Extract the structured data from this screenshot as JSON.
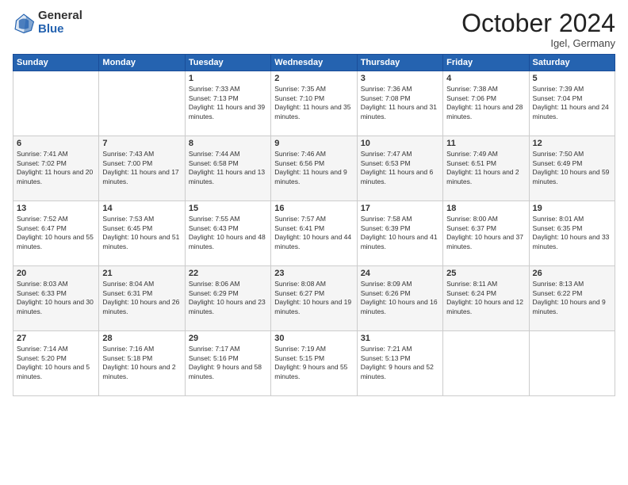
{
  "logo": {
    "general": "General",
    "blue": "Blue"
  },
  "header": {
    "month": "October 2024",
    "location": "Igel, Germany"
  },
  "weekdays": [
    "Sunday",
    "Monday",
    "Tuesday",
    "Wednesday",
    "Thursday",
    "Friday",
    "Saturday"
  ],
  "weeks": [
    [
      {
        "day": "",
        "sunrise": "",
        "sunset": "",
        "daylight": ""
      },
      {
        "day": "",
        "sunrise": "",
        "sunset": "",
        "daylight": ""
      },
      {
        "day": "1",
        "sunrise": "Sunrise: 7:33 AM",
        "sunset": "Sunset: 7:13 PM",
        "daylight": "Daylight: 11 hours and 39 minutes."
      },
      {
        "day": "2",
        "sunrise": "Sunrise: 7:35 AM",
        "sunset": "Sunset: 7:10 PM",
        "daylight": "Daylight: 11 hours and 35 minutes."
      },
      {
        "day": "3",
        "sunrise": "Sunrise: 7:36 AM",
        "sunset": "Sunset: 7:08 PM",
        "daylight": "Daylight: 11 hours and 31 minutes."
      },
      {
        "day": "4",
        "sunrise": "Sunrise: 7:38 AM",
        "sunset": "Sunset: 7:06 PM",
        "daylight": "Daylight: 11 hours and 28 minutes."
      },
      {
        "day": "5",
        "sunrise": "Sunrise: 7:39 AM",
        "sunset": "Sunset: 7:04 PM",
        "daylight": "Daylight: 11 hours and 24 minutes."
      }
    ],
    [
      {
        "day": "6",
        "sunrise": "Sunrise: 7:41 AM",
        "sunset": "Sunset: 7:02 PM",
        "daylight": "Daylight: 11 hours and 20 minutes."
      },
      {
        "day": "7",
        "sunrise": "Sunrise: 7:43 AM",
        "sunset": "Sunset: 7:00 PM",
        "daylight": "Daylight: 11 hours and 17 minutes."
      },
      {
        "day": "8",
        "sunrise": "Sunrise: 7:44 AM",
        "sunset": "Sunset: 6:58 PM",
        "daylight": "Daylight: 11 hours and 13 minutes."
      },
      {
        "day": "9",
        "sunrise": "Sunrise: 7:46 AM",
        "sunset": "Sunset: 6:56 PM",
        "daylight": "Daylight: 11 hours and 9 minutes."
      },
      {
        "day": "10",
        "sunrise": "Sunrise: 7:47 AM",
        "sunset": "Sunset: 6:53 PM",
        "daylight": "Daylight: 11 hours and 6 minutes."
      },
      {
        "day": "11",
        "sunrise": "Sunrise: 7:49 AM",
        "sunset": "Sunset: 6:51 PM",
        "daylight": "Daylight: 11 hours and 2 minutes."
      },
      {
        "day": "12",
        "sunrise": "Sunrise: 7:50 AM",
        "sunset": "Sunset: 6:49 PM",
        "daylight": "Daylight: 10 hours and 59 minutes."
      }
    ],
    [
      {
        "day": "13",
        "sunrise": "Sunrise: 7:52 AM",
        "sunset": "Sunset: 6:47 PM",
        "daylight": "Daylight: 10 hours and 55 minutes."
      },
      {
        "day": "14",
        "sunrise": "Sunrise: 7:53 AM",
        "sunset": "Sunset: 6:45 PM",
        "daylight": "Daylight: 10 hours and 51 minutes."
      },
      {
        "day": "15",
        "sunrise": "Sunrise: 7:55 AM",
        "sunset": "Sunset: 6:43 PM",
        "daylight": "Daylight: 10 hours and 48 minutes."
      },
      {
        "day": "16",
        "sunrise": "Sunrise: 7:57 AM",
        "sunset": "Sunset: 6:41 PM",
        "daylight": "Daylight: 10 hours and 44 minutes."
      },
      {
        "day": "17",
        "sunrise": "Sunrise: 7:58 AM",
        "sunset": "Sunset: 6:39 PM",
        "daylight": "Daylight: 10 hours and 41 minutes."
      },
      {
        "day": "18",
        "sunrise": "Sunrise: 8:00 AM",
        "sunset": "Sunset: 6:37 PM",
        "daylight": "Daylight: 10 hours and 37 minutes."
      },
      {
        "day": "19",
        "sunrise": "Sunrise: 8:01 AM",
        "sunset": "Sunset: 6:35 PM",
        "daylight": "Daylight: 10 hours and 33 minutes."
      }
    ],
    [
      {
        "day": "20",
        "sunrise": "Sunrise: 8:03 AM",
        "sunset": "Sunset: 6:33 PM",
        "daylight": "Daylight: 10 hours and 30 minutes."
      },
      {
        "day": "21",
        "sunrise": "Sunrise: 8:04 AM",
        "sunset": "Sunset: 6:31 PM",
        "daylight": "Daylight: 10 hours and 26 minutes."
      },
      {
        "day": "22",
        "sunrise": "Sunrise: 8:06 AM",
        "sunset": "Sunset: 6:29 PM",
        "daylight": "Daylight: 10 hours and 23 minutes."
      },
      {
        "day": "23",
        "sunrise": "Sunrise: 8:08 AM",
        "sunset": "Sunset: 6:27 PM",
        "daylight": "Daylight: 10 hours and 19 minutes."
      },
      {
        "day": "24",
        "sunrise": "Sunrise: 8:09 AM",
        "sunset": "Sunset: 6:26 PM",
        "daylight": "Daylight: 10 hours and 16 minutes."
      },
      {
        "day": "25",
        "sunrise": "Sunrise: 8:11 AM",
        "sunset": "Sunset: 6:24 PM",
        "daylight": "Daylight: 10 hours and 12 minutes."
      },
      {
        "day": "26",
        "sunrise": "Sunrise: 8:13 AM",
        "sunset": "Sunset: 6:22 PM",
        "daylight": "Daylight: 10 hours and 9 minutes."
      }
    ],
    [
      {
        "day": "27",
        "sunrise": "Sunrise: 7:14 AM",
        "sunset": "Sunset: 5:20 PM",
        "daylight": "Daylight: 10 hours and 5 minutes."
      },
      {
        "day": "28",
        "sunrise": "Sunrise: 7:16 AM",
        "sunset": "Sunset: 5:18 PM",
        "daylight": "Daylight: 10 hours and 2 minutes."
      },
      {
        "day": "29",
        "sunrise": "Sunrise: 7:17 AM",
        "sunset": "Sunset: 5:16 PM",
        "daylight": "Daylight: 9 hours and 58 minutes."
      },
      {
        "day": "30",
        "sunrise": "Sunrise: 7:19 AM",
        "sunset": "Sunset: 5:15 PM",
        "daylight": "Daylight: 9 hours and 55 minutes."
      },
      {
        "day": "31",
        "sunrise": "Sunrise: 7:21 AM",
        "sunset": "Sunset: 5:13 PM",
        "daylight": "Daylight: 9 hours and 52 minutes."
      },
      {
        "day": "",
        "sunrise": "",
        "sunset": "",
        "daylight": ""
      },
      {
        "day": "",
        "sunrise": "",
        "sunset": "",
        "daylight": ""
      }
    ]
  ]
}
